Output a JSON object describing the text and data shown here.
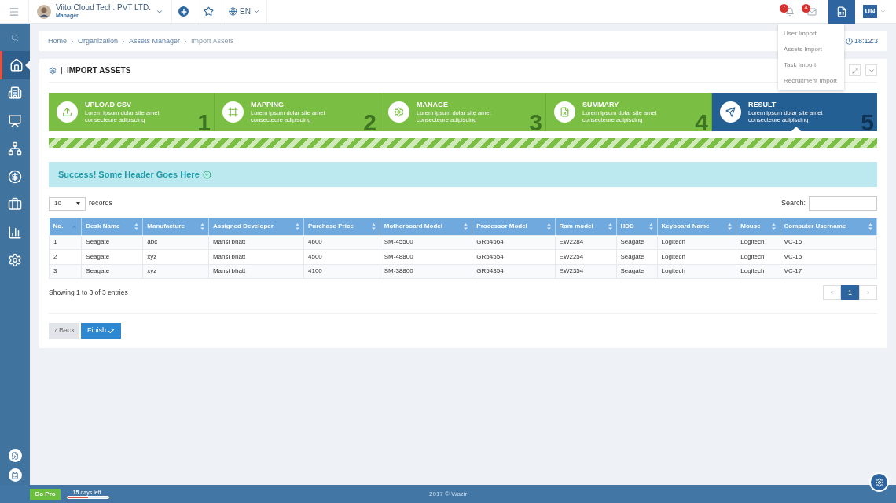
{
  "topbar": {
    "company": "ViitorCloud Tech. PVT LTD.",
    "role": "Manager",
    "language": "EN",
    "notifications": "7",
    "messages": "4",
    "import_active": true,
    "user_initials": "UN"
  },
  "import_menu": [
    "User Import",
    "Assets Import",
    "Task Import",
    "Recruitment Import"
  ],
  "sidebar": {
    "items": [
      {
        "selected": true
      },
      {
        "selected": false
      },
      {
        "selected": false
      },
      {
        "selected": false
      },
      {
        "selected": false
      },
      {
        "selected": false
      },
      {
        "selected": false
      },
      {
        "selected": false
      }
    ]
  },
  "breadcrumb": [
    "Home",
    "Organization",
    "Assets Manager",
    "Import Assets"
  ],
  "time": "18:12:3",
  "panel_title": "IMPORT ASSETS",
  "steps": [
    {
      "title": "UPLOAD CSV",
      "text": "Lorem ipsum dolar site amet consecteure adipiscing",
      "number": "1",
      "selected": false
    },
    {
      "title": "MAPPING",
      "text": "Lorem ipsum dolar site amet consecteure adipiscing",
      "number": "2",
      "selected": false
    },
    {
      "title": "MANAGE",
      "text": "Lorem ipsum dolar site amet consecteure adipiscing",
      "number": "3",
      "selected": false
    },
    {
      "title": "SUMMARY",
      "text": "Lorem ipsum dolar site amet consecteure adipiscing",
      "number": "4",
      "selected": false
    },
    {
      "title": "RESULT",
      "text": "Lorem ipsum dolar site amet consecteure adipiscing",
      "number": "5",
      "selected": true
    }
  ],
  "alert": "Success! Some Header Goes Here",
  "page_size": "10",
  "records_label": "records",
  "search_label": "Search:",
  "table": {
    "columns": [
      {
        "label": "No.",
        "sorted": true
      },
      {
        "label": "Desk Name",
        "sorted": false
      },
      {
        "label": "Manufacture",
        "sorted": false
      },
      {
        "label": "Assigned Developer",
        "sorted": false
      },
      {
        "label": "Purchase Price",
        "sorted": false
      },
      {
        "label": "Motherboard Model",
        "sorted": false
      },
      {
        "label": "Processor Model",
        "sorted": false
      },
      {
        "label": "Ram model",
        "sorted": false
      },
      {
        "label": "HDD",
        "sorted": false
      },
      {
        "label": "Keyboard Name",
        "sorted": false
      },
      {
        "label": "Mouse",
        "sorted": false
      },
      {
        "label": "Computer Username",
        "sorted": false
      }
    ],
    "rows": [
      [
        "1",
        "Seagate",
        "abc",
        "Mansi bhatt",
        "4600",
        "SM-45500",
        "GR54564",
        "EW2284",
        "Seagate",
        "Logitech",
        "Logitech",
        "VC-16"
      ],
      [
        "2",
        "Seagate",
        "xyz",
        "Mansi bhatt",
        "4500",
        "SM-48800",
        "GR54554",
        "EW2254",
        "Seagate",
        "Logitech",
        "Logitech",
        "VC-15"
      ],
      [
        "3",
        "Seagate",
        "xyz",
        "Mansi bhatt",
        "4100",
        "SM-38800",
        "GR54354",
        "EW2354",
        "Seagate",
        "Logitech",
        "Logitech",
        "VC-17"
      ]
    ]
  },
  "entries_info": "Showing 1 to 3 of 3 entries",
  "pagination": [
    {
      "label": "‹",
      "selected": false
    },
    {
      "label": "1",
      "selected": true
    },
    {
      "label": "›",
      "selected": false
    }
  ],
  "buttons": {
    "back": "Back",
    "finish": "Finish"
  },
  "footer": {
    "go_pro": "Go Pro",
    "trial": "**15** days left",
    "trial_bar": {
      "level": 0.5
    },
    "copyright": "2017 © Wazir"
  }
}
